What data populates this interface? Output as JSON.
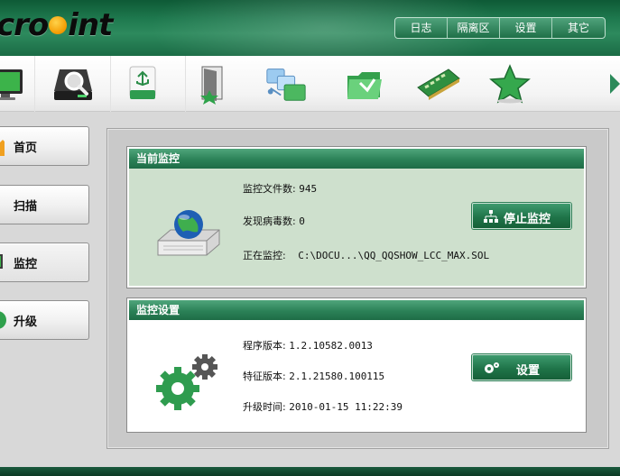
{
  "app": {
    "logo_text_left": "cro",
    "logo_text_right": "int"
  },
  "top_menu": {
    "items": [
      "日志",
      "隔离区",
      "设置",
      "其它"
    ]
  },
  "toolbar": {
    "icons": [
      "monitor-icon",
      "disk-scan-icon",
      "usb-drive-icon",
      "door-exit-icon",
      "network-folder-icon",
      "green-folder-icon",
      "memory-module-icon",
      "star-icon"
    ]
  },
  "sidebar": {
    "items": [
      {
        "label": "首页"
      },
      {
        "label": "扫描"
      },
      {
        "label": "监控"
      },
      {
        "label": "升级"
      }
    ],
    "active_index": 2
  },
  "monitor_panel": {
    "title": "当前监控",
    "files_label": "监控文件数:",
    "files_value": "945",
    "virus_label": "发现病毒数:",
    "virus_value": "0",
    "current_label": "正在监控:",
    "current_value": "C:\\DOCU...\\QQ_QQSHOW_LCC_MAX.SOL",
    "stop_button": "停止监控"
  },
  "settings_panel": {
    "title": "监控设置",
    "program_version_label": "程序版本:",
    "program_version_value": "1.2.10582.0013",
    "signature_version_label": "特征版本:",
    "signature_version_value": "2.1.21580.100115",
    "upgrade_time_label": "升级时间:",
    "upgrade_time_value": "2010-01-15 11:22:39",
    "settings_button": "设置"
  },
  "colors": {
    "header_green": "#1f7a4f",
    "panel_green": "#2b8157",
    "monitor_body": "#cee0cd"
  }
}
